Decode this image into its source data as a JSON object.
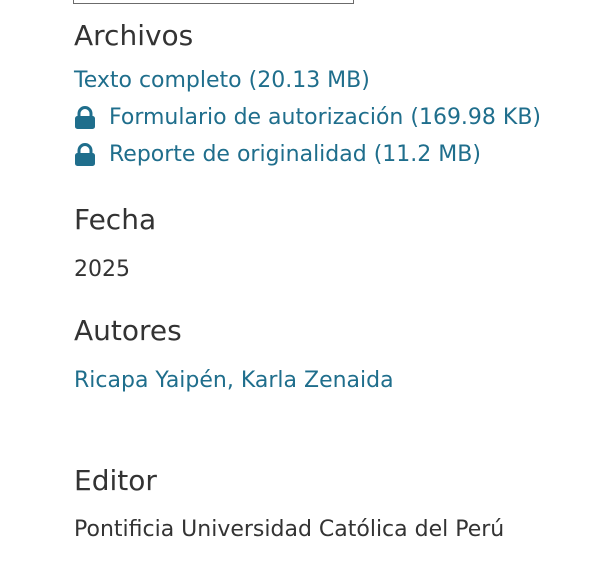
{
  "archivos": {
    "heading": "Archivos",
    "files": [
      {
        "label": "Texto completo (20.13 MB)",
        "locked": false
      },
      {
        "label": "Formulario de autorización (169.98 KB)",
        "locked": true,
        "icon": "lock-icon"
      },
      {
        "label": "Reporte de originalidad (11.2 MB)",
        "locked": true,
        "icon": "lock-icon"
      }
    ]
  },
  "fecha": {
    "heading": "Fecha",
    "value": "2025"
  },
  "autores": {
    "heading": "Autores",
    "value": "Ricapa Yaipén, Karla Zenaida"
  },
  "editor": {
    "heading": "Editor",
    "value": "Pontificia Universidad Católica del Perú"
  },
  "colors": {
    "link": "#1f6e8c",
    "text": "#333333"
  }
}
